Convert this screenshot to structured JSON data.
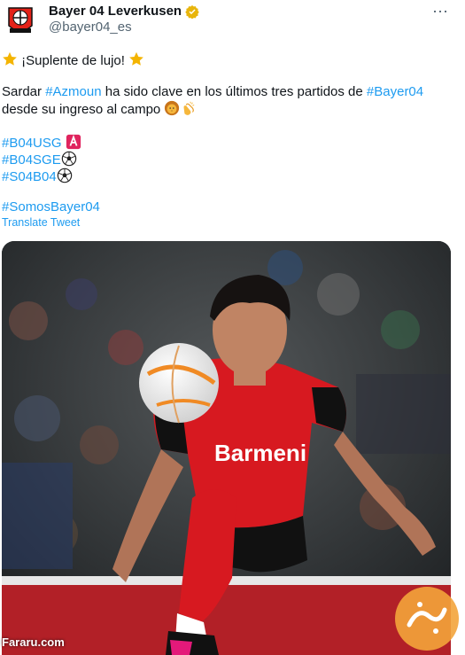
{
  "account": {
    "display_name": "Bayer 04 Leverkusen",
    "handle": "@bayer04_es",
    "verified_color": "#e8b50c"
  },
  "more_icon": "⋯",
  "tweet": {
    "line1_text": "¡Suplente de lujo!",
    "line2_pre": "Sardar ",
    "line2_tag1": "#Azmoun",
    "line2_mid": " ha sido clave en los últimos tres partidos de ",
    "line2_tag2": "#Bayer04",
    "line3_text": "desde su ingreso al campo",
    "tag_b04usg": "#B04USG",
    "tag_b04sge": "#B04SGE",
    "tag_s04b04": "#S04B04",
    "tag_somos": "#SomosBayer04"
  },
  "translate_label": "Translate Tweet",
  "watermark": {
    "site": "Fararu.com"
  },
  "colors": {
    "link": "#1d9bf0",
    "jersey_red": "#d71920",
    "watermark_orange": "#f3a43b"
  },
  "icons": [
    "star-icon",
    "lion-icon",
    "clap-icon",
    "a-button-icon",
    "soccer-ball-icon",
    "verified-badge-icon",
    "more-icon"
  ]
}
